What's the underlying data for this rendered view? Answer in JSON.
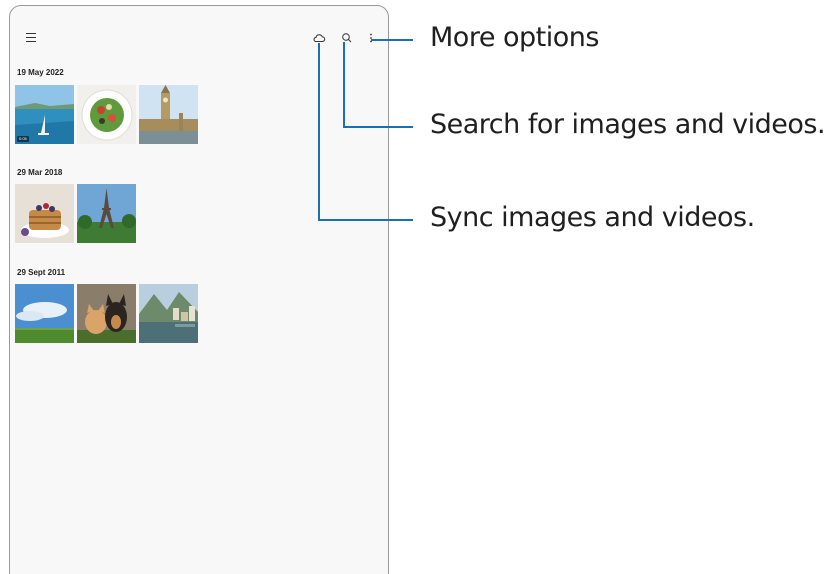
{
  "toolbar": {
    "menu_icon": "hamburger-menu-icon",
    "cloud_icon": "cloud-icon",
    "search_icon": "search-icon",
    "more_icon": "more-vertical-icon"
  },
  "groups": [
    {
      "date": "19 May 2022",
      "thumbnails": [
        "sea-sailboat",
        "salad-plate",
        "big-ben-london"
      ],
      "video_badge": "0:05"
    },
    {
      "date": "29 Mar 2018",
      "thumbnails": [
        "pancakes-berries",
        "eiffel-tower"
      ]
    },
    {
      "date": "29 Sept 2011",
      "thumbnails": [
        "sky-field",
        "cat-and-dog",
        "lakeside-village"
      ]
    }
  ],
  "callouts": {
    "more_options": "More options",
    "search": "Search for images and videos.",
    "sync": "Sync images and videos."
  },
  "colors": {
    "callout_line": "#1b6fb5",
    "screen_bg": "#f8f8f8",
    "frame": "#9a9a9a"
  }
}
